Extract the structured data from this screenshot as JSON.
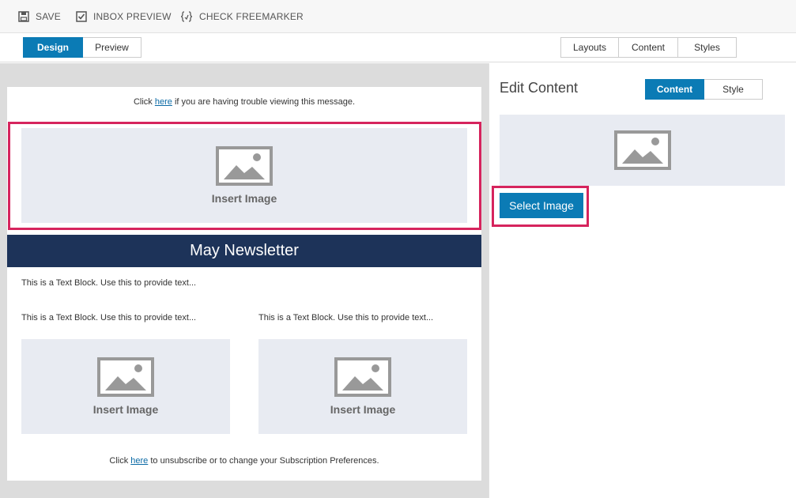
{
  "toolbar": {
    "save_label": "SAVE",
    "inbox_preview_label": "INBOX PREVIEW",
    "check_freemarker_label": "CHECK FREEMARKER"
  },
  "view_tabs": [
    {
      "label": "Design",
      "active": true
    },
    {
      "label": "Preview",
      "active": false
    }
  ],
  "right_tabs": [
    {
      "label": "Layouts"
    },
    {
      "label": "Content"
    },
    {
      "label": "Styles"
    }
  ],
  "email": {
    "top_text_before": "Click ",
    "top_link": "here",
    "top_text_after": " if you are having trouble viewing this message.",
    "hero_image_label": "Insert Image",
    "banner_title": "May Newsletter",
    "text_block_1": "This is a Text Block. Use this to provide text...",
    "col_left_text": "This is a Text Block. Use this to provide text...",
    "col_right_text": "This is a Text Block. Use this to provide text...",
    "col_left_image_label": "Insert Image",
    "col_right_image_label": "Insert Image",
    "footer_text_before": "Click ",
    "footer_link": "here",
    "footer_text_after": " to unsubscribe or to change your Subscription Preferences."
  },
  "panel": {
    "title": "Edit Content",
    "tabs": [
      {
        "label": "Content",
        "active": true
      },
      {
        "label": "Style",
        "active": false
      }
    ],
    "select_image_label": "Select Image"
  },
  "colors": {
    "accent": "#0b7bb5",
    "highlight": "#d6245d",
    "banner": "#1d3359",
    "placeholder_bg": "#e8ebf2"
  }
}
